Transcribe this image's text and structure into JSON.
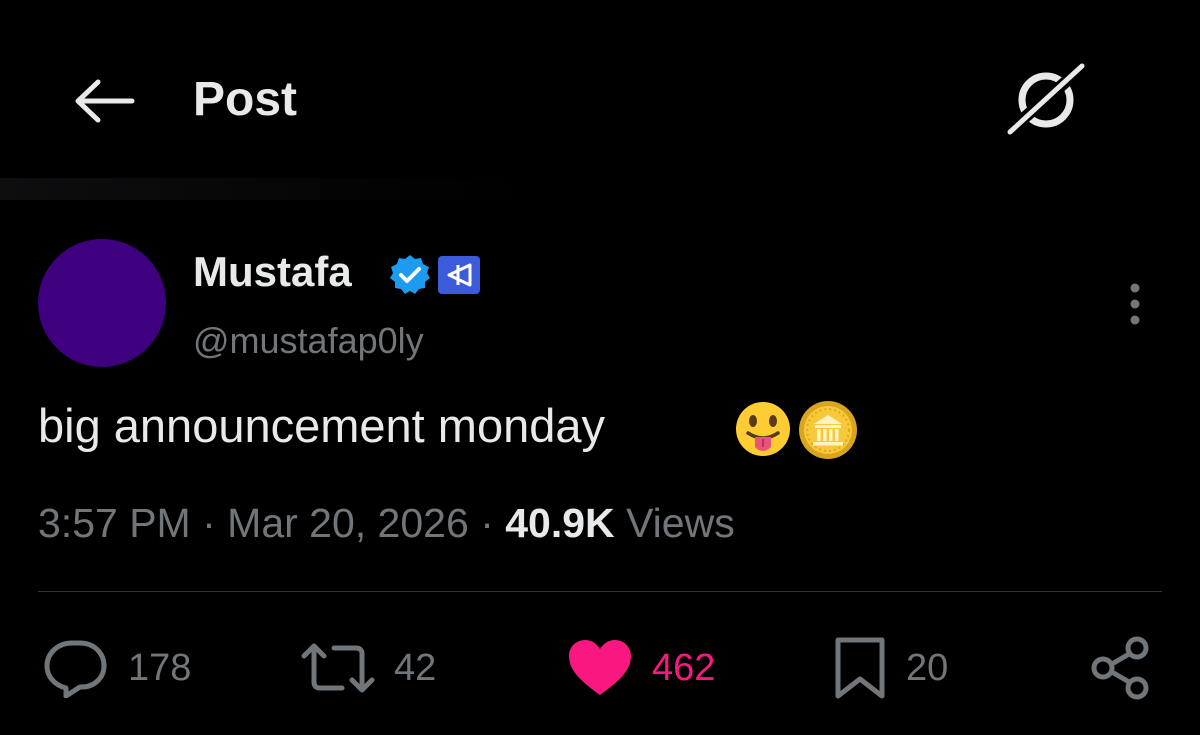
{
  "header": {
    "title": "Post",
    "back_icon": "arrow-left-icon",
    "grok_icon": "grok-icon"
  },
  "post": {
    "author": {
      "display_name": "Mustafa",
      "handle": "@mustafap0ly",
      "avatar_color": "#3f0080",
      "verified_icon": "verified-badge-icon",
      "verified_color": "#1d9bf0",
      "affiliate_badge_icon": "affiliate-logo-icon",
      "affiliate_badge_color": "#3b5bdb"
    },
    "text": "big announcement monday",
    "emojis": [
      "tongue-out-face-emoji",
      "coin-emoji"
    ],
    "time": "3:57 PM",
    "date": "Mar 20, 2026",
    "separator": "·",
    "views_count": "40.9K",
    "views_label": "Views"
  },
  "actions": {
    "reply_count": "178",
    "repost_count": "42",
    "like_count": "462",
    "like_color": "#f91880",
    "bookmark_count": "20"
  }
}
